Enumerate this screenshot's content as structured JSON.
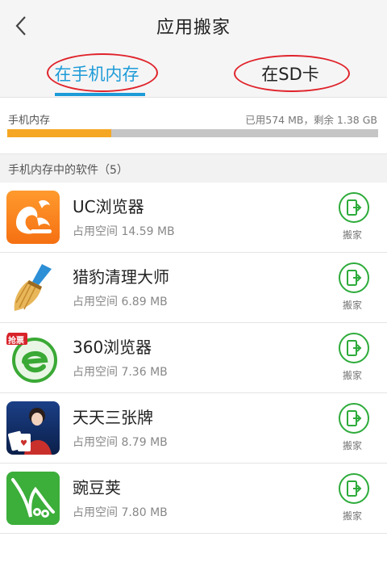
{
  "header": {
    "title": "应用搬家",
    "back_icon": "chevron-left-icon"
  },
  "tabs": [
    {
      "label": "在手机内存",
      "selected": true
    },
    {
      "label": "在SD卡",
      "selected": false
    }
  ],
  "storage": {
    "label": "手机内存",
    "usage_text": "已用574 MB，剩余 1.38 GB",
    "used_fraction": 0.28,
    "fill_color": "#f5a623",
    "track_color": "#c5c5c5"
  },
  "section": {
    "title": "手机内存中的软件（5）"
  },
  "apps": [
    {
      "name": "UC浏览器",
      "size": "占用空间 14.59 MB",
      "action": "搬家",
      "icon": "uc-browser-icon"
    },
    {
      "name": "猎豹清理大师",
      "size": "占用空间 6.89 MB",
      "action": "搬家",
      "icon": "broom-icon"
    },
    {
      "name": "360浏览器",
      "size": "占用空间 7.36 MB",
      "action": "搬家",
      "icon": "360-browser-icon",
      "badge": "抢票"
    },
    {
      "name": "天天三张牌",
      "size": "占用空间 8.79 MB",
      "action": "搬家",
      "icon": "card-game-icon"
    },
    {
      "name": "豌豆荚",
      "size": "占用空间 7.80 MB",
      "action": "搬家",
      "icon": "pea-pod-icon"
    }
  ],
  "colors": {
    "accent": "#1d9bd8",
    "move_green": "#2dab3a",
    "annotation_red": "#e0232b"
  }
}
